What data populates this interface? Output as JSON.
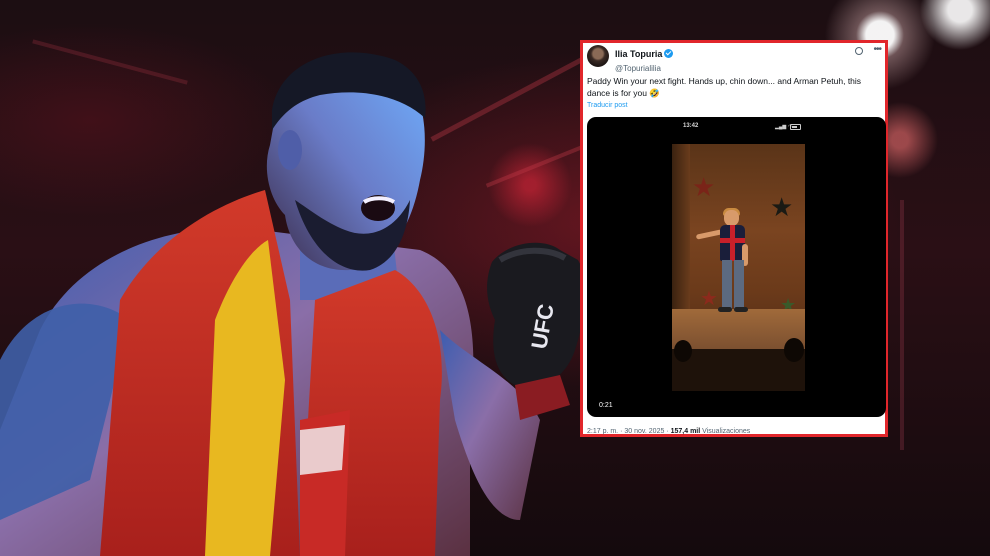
{
  "tweet": {
    "display_name": "Ilia Topuria",
    "handle": "@Topurialilia",
    "verified_icon": "verified-badge-icon",
    "text": "Paddy Win your next fight. Hands up, chin down... and Arman Petuh, this dance is for you 🤣",
    "translate_label": "Traducir post",
    "video": {
      "phone_time": "13:42",
      "phone_status_icons": "▂▄▆ ◠",
      "duration": "0:21"
    },
    "meta": {
      "time": "2:17 p. m.",
      "separator": "·",
      "date": "30 nov. 2025",
      "separator2": "·",
      "views_count": "157,4 mil",
      "views_label": "Visualizaciones"
    }
  },
  "background": {
    "glove_logo": "UFC",
    "accent_color": "#e1262b",
    "link_color": "#1d9bf0"
  }
}
